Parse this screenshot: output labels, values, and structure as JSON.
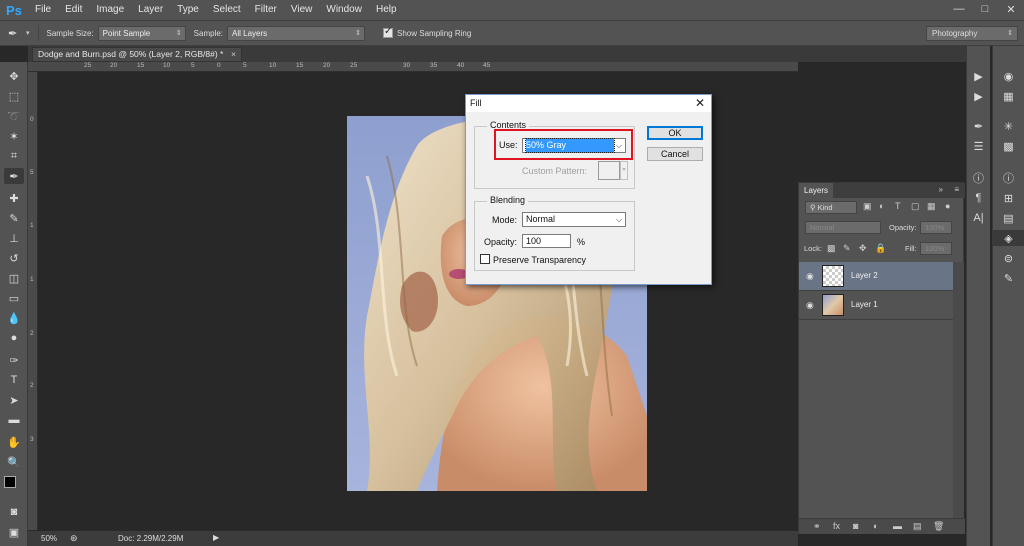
{
  "app": {
    "logo": "Ps",
    "menu": [
      "File",
      "Edit",
      "Image",
      "Layer",
      "Type",
      "Select",
      "Filter",
      "View",
      "Window",
      "Help"
    ],
    "window_buttons": [
      "—",
      "□",
      "✕"
    ]
  },
  "options_bar": {
    "sample_size_label": "Sample Size:",
    "sample_size_value": "Point Sample",
    "sample_label": "Sample:",
    "sample_value": "All Layers",
    "show_sampling_ring_label": "Show Sampling Ring",
    "show_sampling_ring_checked": true
  },
  "workspace": {
    "value": "Photography"
  },
  "document": {
    "tab_title": "Dodge and Burn.psd @ 50% (Layer 2, RGB/8#) *",
    "close_symbol": "×"
  },
  "ruler": {
    "h_ticks": [
      "25",
      "20",
      "15",
      "10",
      "5",
      "0",
      "5",
      "10",
      "15",
      "20",
      "25",
      "30",
      "35",
      "40",
      "45"
    ],
    "v_ticks": [
      "0",
      "5",
      "1",
      "1",
      "2",
      "2",
      "3"
    ]
  },
  "status": {
    "zoom": "50%",
    "doc": "Doc: 2.29M/2.29M"
  },
  "fill_dialog": {
    "title": "Fill",
    "close": "✕",
    "contents_label": "Contents",
    "use_label": "Use:",
    "use_value": "50% Gray",
    "custom_pattern_label": "Custom Pattern:",
    "blending_label": "Blending",
    "mode_label": "Mode:",
    "mode_value": "Normal",
    "opacity_label": "Opacity:",
    "opacity_value": "100",
    "opacity_unit": "%",
    "preserve_label": "Preserve Transparency",
    "preserve_checked": false,
    "ok_label": "OK",
    "cancel_label": "Cancel",
    "highlight_color": "#e0141e"
  },
  "layers_panel": {
    "tab": "Layers",
    "kind_label": "Kind",
    "blend_mode": "Normal",
    "opacity_label": "Opacity:",
    "opacity_value": "100%",
    "lock_label": "Lock:",
    "fill_label": "Fill:",
    "fill_value": "100%",
    "layers": [
      {
        "name": "Layer 2",
        "selected": true
      },
      {
        "name": "Layer 1",
        "selected": false
      }
    ]
  },
  "colors": {
    "accent": "#31a8ff",
    "selected_layer": "#697586",
    "dialog_select": "#3399ff"
  }
}
